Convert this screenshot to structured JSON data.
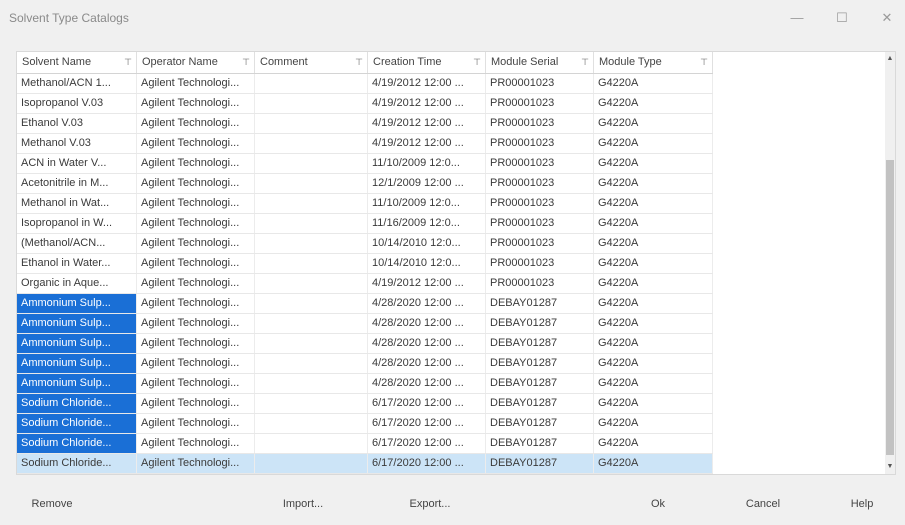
{
  "window": {
    "title": "Solvent Type Catalogs",
    "minimize": "—",
    "maximize": "☐",
    "close": "✕"
  },
  "grid": {
    "filter_glyph": "⊤",
    "columns": [
      "Solvent Name",
      "Operator Name",
      "Comment",
      "Creation Time",
      "Module Serial",
      "Module Type"
    ],
    "rows": [
      {
        "name": "Methanol/ACN 1...",
        "operator": "Agilent Technologi...",
        "comment": "",
        "time": "4/19/2012 12:00 ...",
        "serial": "PR00001023",
        "type": "G4220A",
        "name_selected": false,
        "row_selected": false
      },
      {
        "name": "Isopropanol V.03",
        "operator": "Agilent Technologi...",
        "comment": "",
        "time": "4/19/2012 12:00 ...",
        "serial": "PR00001023",
        "type": "G4220A",
        "name_selected": false,
        "row_selected": false
      },
      {
        "name": "Ethanol V.03",
        "operator": "Agilent Technologi...",
        "comment": "",
        "time": "4/19/2012 12:00 ...",
        "serial": "PR00001023",
        "type": "G4220A",
        "name_selected": false,
        "row_selected": false
      },
      {
        "name": "Methanol V.03",
        "operator": "Agilent Technologi...",
        "comment": "",
        "time": "4/19/2012 12:00 ...",
        "serial": "PR00001023",
        "type": "G4220A",
        "name_selected": false,
        "row_selected": false
      },
      {
        "name": "ACN in Water V...",
        "operator": "Agilent Technologi...",
        "comment": "",
        "time": "11/10/2009 12:0...",
        "serial": "PR00001023",
        "type": "G4220A",
        "name_selected": false,
        "row_selected": false
      },
      {
        "name": "Acetonitrile in M...",
        "operator": "Agilent Technologi...",
        "comment": "",
        "time": "12/1/2009 12:00 ...",
        "serial": "PR00001023",
        "type": "G4220A",
        "name_selected": false,
        "row_selected": false
      },
      {
        "name": "Methanol in Wat...",
        "operator": "Agilent Technologi...",
        "comment": "",
        "time": "11/10/2009 12:0...",
        "serial": "PR00001023",
        "type": "G4220A",
        "name_selected": false,
        "row_selected": false
      },
      {
        "name": "Isopropanol in W...",
        "operator": "Agilent Technologi...",
        "comment": "",
        "time": "11/16/2009 12:0...",
        "serial": "PR00001023",
        "type": "G4220A",
        "name_selected": false,
        "row_selected": false
      },
      {
        "name": "(Methanol/ACN...",
        "operator": "Agilent Technologi...",
        "comment": "",
        "time": "10/14/2010 12:0...",
        "serial": "PR00001023",
        "type": "G4220A",
        "name_selected": false,
        "row_selected": false
      },
      {
        "name": "Ethanol in Water...",
        "operator": "Agilent Technologi...",
        "comment": "",
        "time": "10/14/2010 12:0...",
        "serial": "PR00001023",
        "type": "G4220A",
        "name_selected": false,
        "row_selected": false
      },
      {
        "name": "Organic in Aque...",
        "operator": "Agilent Technologi...",
        "comment": "",
        "time": "4/19/2012 12:00 ...",
        "serial": "PR00001023",
        "type": "G4220A",
        "name_selected": false,
        "row_selected": false
      },
      {
        "name": "Ammonium Sulp...",
        "operator": "Agilent Technologi...",
        "comment": "",
        "time": "4/28/2020 12:00 ...",
        "serial": "DEBAY01287",
        "type": "G4220A",
        "name_selected": true,
        "row_selected": false
      },
      {
        "name": "Ammonium Sulp...",
        "operator": "Agilent Technologi...",
        "comment": "",
        "time": "4/28/2020 12:00 ...",
        "serial": "DEBAY01287",
        "type": "G4220A",
        "name_selected": true,
        "row_selected": false
      },
      {
        "name": "Ammonium Sulp...",
        "operator": "Agilent Technologi...",
        "comment": "",
        "time": "4/28/2020 12:00 ...",
        "serial": "DEBAY01287",
        "type": "G4220A",
        "name_selected": true,
        "row_selected": false
      },
      {
        "name": "Ammonium Sulp...",
        "operator": "Agilent Technologi...",
        "comment": "",
        "time": "4/28/2020 12:00 ...",
        "serial": "DEBAY01287",
        "type": "G4220A",
        "name_selected": true,
        "row_selected": false
      },
      {
        "name": "Ammonium Sulp...",
        "operator": "Agilent Technologi...",
        "comment": "",
        "time": "4/28/2020 12:00 ...",
        "serial": "DEBAY01287",
        "type": "G4220A",
        "name_selected": true,
        "row_selected": false
      },
      {
        "name": "Sodium Chloride...",
        "operator": "Agilent Technologi...",
        "comment": "",
        "time": "6/17/2020 12:00 ...",
        "serial": "DEBAY01287",
        "type": "G4220A",
        "name_selected": true,
        "row_selected": false
      },
      {
        "name": "Sodium Chloride...",
        "operator": "Agilent Technologi...",
        "comment": "",
        "time": "6/17/2020 12:00 ...",
        "serial": "DEBAY01287",
        "type": "G4220A",
        "name_selected": true,
        "row_selected": false
      },
      {
        "name": "Sodium Chloride...",
        "operator": "Agilent Technologi...",
        "comment": "",
        "time": "6/17/2020 12:00 ...",
        "serial": "DEBAY01287",
        "type": "G4220A",
        "name_selected": true,
        "row_selected": false
      },
      {
        "name": "Sodium Chloride...",
        "operator": "Agilent Technologi...",
        "comment": "",
        "time": "6/17/2020 12:00 ...",
        "serial": "DEBAY01287",
        "type": "G4220A",
        "name_selected": false,
        "row_selected": true
      }
    ]
  },
  "scrollbar": {
    "up_glyph": "▲",
    "down_glyph": "▼"
  },
  "buttons": {
    "remove": "Remove",
    "import": "Import...",
    "export": "Export...",
    "ok": "Ok",
    "cancel": "Cancel",
    "help": "Help"
  },
  "colors": {
    "selection_cell": "#1a6fd6",
    "selection_row": "#cce4f7"
  }
}
